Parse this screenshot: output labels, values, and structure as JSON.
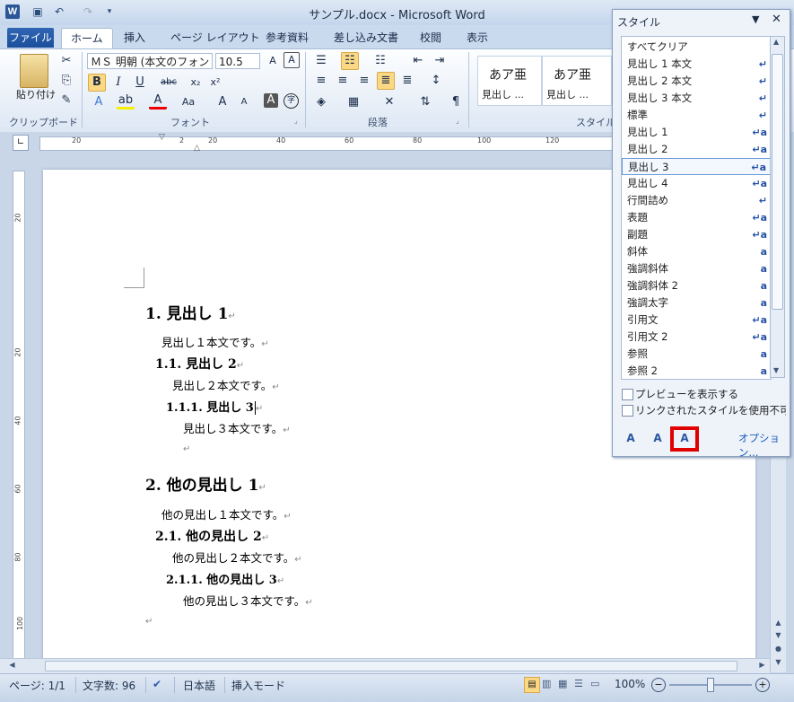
{
  "window": {
    "title": "サンプル.docx - Microsoft Word",
    "app_icon": "W",
    "controls": {
      "minimize": "–",
      "maximize": "□",
      "close": "✕"
    }
  },
  "ribbon": {
    "tabs": [
      {
        "label": "ファイル"
      },
      {
        "label": "ホーム"
      },
      {
        "label": "挿入"
      },
      {
        "label": "ページ レイアウト"
      },
      {
        "label": "参考資料"
      },
      {
        "label": "差し込み文書"
      },
      {
        "label": "校閲"
      },
      {
        "label": "表示"
      }
    ],
    "paste_label": "貼り付け",
    "font_name": "ＭＳ 明朝 (本文のフォン",
    "font_size": "10.5",
    "group_labels": {
      "clipboard": "クリップボード",
      "font": "フォント",
      "paragraph": "段落",
      "styles": "スタイル"
    },
    "style_gallery": [
      {
        "preview": "あア亜",
        "name": "見出し ..."
      },
      {
        "preview": "あア亜",
        "name": "見出し ..."
      }
    ]
  },
  "ruler": {
    "numbers": [
      "20",
      "2",
      "20",
      "40",
      "60",
      "80",
      "100",
      "120"
    ],
    "vertical_numbers": [
      "20",
      "20",
      "40",
      "60",
      "80",
      "100"
    ]
  },
  "document": {
    "lines": [
      {
        "text": "1. 見出し 1",
        "level": "h1"
      },
      {
        "text": "見出し１本文です。",
        "level": "body1"
      },
      {
        "text": "1.1. 見出し 2",
        "level": "h2"
      },
      {
        "text": "見出し２本文です。",
        "level": "body2"
      },
      {
        "text": "1.1.1. 見出し 3",
        "level": "h3"
      },
      {
        "text": "見出し３本文です。",
        "level": "body3"
      },
      {
        "text": "",
        "level": "empty"
      },
      {
        "text": "2. 他の見出し 1",
        "level": "h1"
      },
      {
        "text": "他の見出し１本文です。",
        "level": "body1"
      },
      {
        "text": "2.1. 他の見出し 2",
        "level": "h2"
      },
      {
        "text": "他の見出し２本文です。",
        "level": "body2"
      },
      {
        "text": "2.1.1. 他の見出し 3",
        "level": "h3"
      },
      {
        "text": "他の見出し３本文です。",
        "level": "body3"
      },
      {
        "text": "",
        "level": "empty0"
      }
    ],
    "paragraph_mark": "↵"
  },
  "styles_pane": {
    "title": "スタイル",
    "items": [
      {
        "name": "すべてクリア",
        "icon": ""
      },
      {
        "name": "見出し 1 本文",
        "icon": "↵"
      },
      {
        "name": "見出し 2 本文",
        "icon": "↵"
      },
      {
        "name": "見出し 3 本文",
        "icon": "↵"
      },
      {
        "name": "標準",
        "icon": "↵"
      },
      {
        "name": "見出し 1",
        "icon": "↵a"
      },
      {
        "name": "見出し 2",
        "icon": "↵a"
      },
      {
        "name": "見出し 3",
        "icon": "↵a"
      },
      {
        "name": "見出し 4",
        "icon": "↵a"
      },
      {
        "name": "行間詰め",
        "icon": "↵"
      },
      {
        "name": "表題",
        "icon": "↵a"
      },
      {
        "name": "副題",
        "icon": "↵a"
      },
      {
        "name": "斜体",
        "icon": "a"
      },
      {
        "name": "強調斜体",
        "icon": "a"
      },
      {
        "name": "強調斜体 2",
        "icon": "a"
      },
      {
        "name": "強調太字",
        "icon": "a"
      },
      {
        "name": "引用文",
        "icon": "↵a"
      },
      {
        "name": "引用文 2",
        "icon": "↵a"
      },
      {
        "name": "参照",
        "icon": "a"
      },
      {
        "name": "参照 2",
        "icon": "a"
      }
    ],
    "selected_index": 7,
    "show_preview_label": "プレビューを表示する",
    "disable_linked_label": "リンクされたスタイルを使用不可にする",
    "options_label": "オプション..."
  },
  "status_bar": {
    "page": "ページ: 1/1",
    "word_count": "文字数: 96",
    "language": "日本語",
    "mode": "挿入モード",
    "zoom": "100%"
  }
}
